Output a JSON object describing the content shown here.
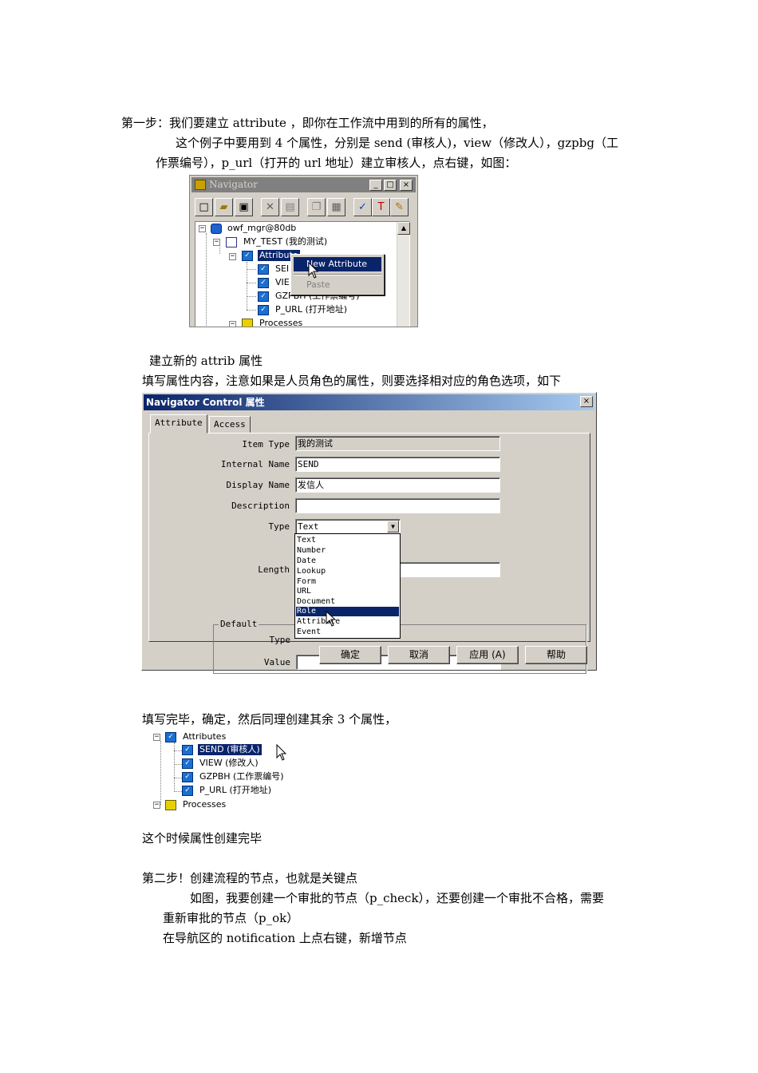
{
  "text": {
    "p1": "第一步：我们要建立 attribute ，即你在工作流中用到的所有的属性，",
    "p2a": "这个例子中要用到 4 个属性，分别是 send (审核人)，view（修改人），gzpbg（工",
    "p2b": "作票编号），p_url（打开的 url 地址）建立审核人，点右键，如图：",
    "p3": "建立新的 attrib 属性",
    "p4": "填写属性内容，注意如果是人员角色的属性，则要选择相对应的角色选项，如下",
    "p5": "填写完毕，确定，然后同理创建其余 3 个属性，",
    "p6": "这个时候属性创建完毕",
    "p7": "第二步！创建流程的节点，也就是关键点",
    "p8a": "如图，我要创建一个审批的节点（p_check），还要创建一个审批不合格，需要",
    "p8b": "重新审批的节点（p_ok）",
    "p9": "在导航区的 notification 上点右键，新增节点"
  },
  "navigator": {
    "title": "Navigator",
    "window_buttons": [
      "_",
      "□",
      "×"
    ],
    "toolbar_icons": [
      "new-icon",
      "open-icon",
      "save-icon",
      "delete-icon",
      "properties-icon",
      "copy-icon",
      "paste-icon",
      "verify-icon",
      "hammer-icon",
      "wand-icon"
    ],
    "tree": {
      "root": "owf_mgr@80db",
      "item_type": "MY_TEST (我的测试)",
      "attributes_label": "Attribute",
      "children": [
        "SEI",
        "VIE",
        "GZPBH (工作票编号)",
        "P_URL (打开地址)"
      ],
      "processes": "Processes"
    },
    "context_menu": {
      "new_attribute": "New Attribute",
      "paste": "Paste"
    }
  },
  "dialog": {
    "title": "Navigator Control 属性",
    "close": "×",
    "tabs": [
      "Attribute",
      "Access"
    ],
    "labels": {
      "item_type": "Item Type",
      "internal_name": "Internal Name",
      "display_name": "Display Name",
      "description": "Description",
      "type": "Type",
      "length": "Length",
      "default_group": "Default",
      "default_type": "Type",
      "default_value": "Value"
    },
    "values": {
      "item_type": "我的测试",
      "internal_name": "SEND",
      "display_name": "发信人",
      "description": "",
      "type": "Text"
    },
    "type_options": [
      "Text",
      "Number",
      "Date",
      "Lookup",
      "Form",
      "URL",
      "Document",
      "Role",
      "Attribute",
      "Event"
    ],
    "highlighted_option": "Role",
    "buttons": {
      "ok": "确定",
      "cancel": "取消",
      "apply": "应用 (A)",
      "help": "帮助"
    }
  },
  "tree2": {
    "attributes": "Attributes",
    "items": [
      "SEND (审核人)",
      "VIEW (修改人)",
      "GZPBH (工作票编号)",
      "P_URL (打开地址)"
    ],
    "processes": "Processes"
  }
}
